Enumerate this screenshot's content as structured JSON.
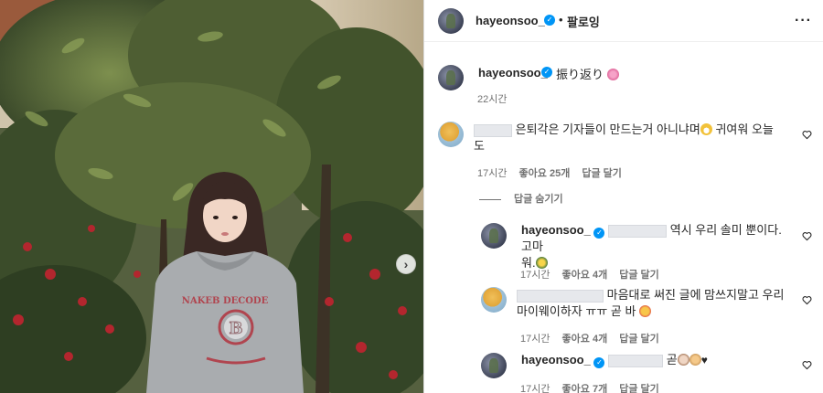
{
  "header": {
    "username": "hayeonsoo_",
    "separator": "•",
    "follow_label": "팔로잉",
    "more_label": "···"
  },
  "caption": {
    "username": "hayeonsoo_",
    "text": "振り返り",
    "time": "22시간"
  },
  "comments": [
    {
      "text_line1": "은퇴각은 기자들이 만드는거 아니냐며",
      "text_after_emoji": "귀여워 오늘",
      "text_line2": "도",
      "time": "17시간",
      "likes": "좋아요 25개",
      "reply": "답글 달기"
    }
  ],
  "hide_replies_label": "답글 숨기기",
  "replies": [
    {
      "username": "hayeonsoo_",
      "text_line1": "역시 우리 솔미 뿐이다. 고마",
      "text_line2": "워.",
      "time": "17시간",
      "likes": "좋아요 4개",
      "reply": "답글 달기"
    },
    {
      "text_line1": "마음대로 써진 글에 맘쓰지말고 우리",
      "text_line2": "마이웨이하자 ㅠㅠ 곧 바",
      "time": "17시간",
      "likes": "좋아요 4개",
      "reply": "답글 달기"
    },
    {
      "username": "hayeonsoo_",
      "text_line1": "곧",
      "time": "17시간",
      "likes": "좋아요 7개",
      "reply": "답글 달기"
    }
  ],
  "photo": {
    "hoodie_badge_letter": "B",
    "next_arrow": "›"
  },
  "colors": {
    "verified": "#0095f6",
    "meta_text": "#737373",
    "text": "#262626"
  }
}
